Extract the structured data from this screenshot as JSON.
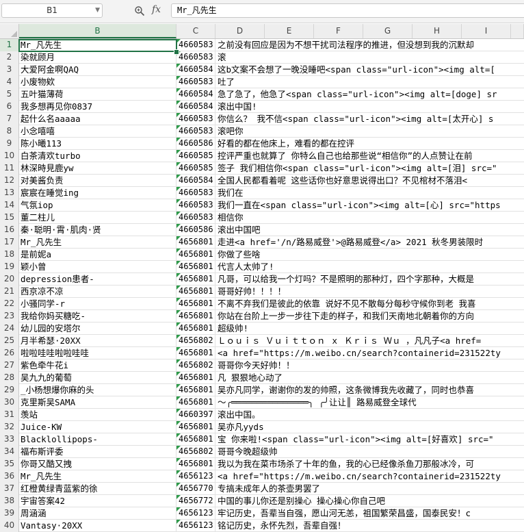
{
  "formula_bar": {
    "namebox": "B1",
    "fx_label": "fx",
    "content": "Mr_凡先生"
  },
  "columns": [
    "B",
    "C",
    "D",
    "E",
    "F",
    "G",
    "H",
    "I"
  ],
  "selected_column": "B",
  "rows": [
    {
      "n": "1",
      "b": "Mr_凡先生",
      "c": "4660583",
      "d": "之前没有回应是因为不想干扰司法程序的推进，但没想到我的沉默却"
    },
    {
      "n": "2",
      "b": "染就顾月",
      "c": "4660583",
      "d": "滚"
    },
    {
      "n": "3",
      "b": "大爱阿金啊QAQ",
      "c": "4660584",
      "d": "这b文案不会想了一晚没睡吧<span class=\"url-icon\"><img alt=["
    },
    {
      "n": "4",
      "b": "小废物欸",
      "c": "4660583",
      "d": "吐了"
    },
    {
      "n": "5",
      "b": "五叶猫薄荷",
      "c": "4660584",
      "d": "急了急了，他急了<span class=\"url-icon\"><img alt=[doge] sr"
    },
    {
      "n": "6",
      "b": "我多想再见你0837",
      "c": "4660584",
      "d": "滚出中国!"
    },
    {
      "n": "7",
      "b": "起什么名aaaaa",
      "c": "4660583",
      "d": "你信么？ 我不信<span class=\"url-icon\"><img alt=[太开心] s"
    },
    {
      "n": "8",
      "b": "小念嘻嘻",
      "c": "4660583",
      "d": "滚吧你"
    },
    {
      "n": "9",
      "b": "陈小曦113",
      "c": "4660586",
      "d": "好看的都在他床上，难看的都在控评"
    },
    {
      "n": "10",
      "b": "白茶清欢turbo",
      "c": "4660585",
      "d": "控评严重也就算了 你特么自己也给那些说“相信你”的人点赞让在前"
    },
    {
      "n": "11",
      "b": "林深時見鹿yw",
      "c": "4660585",
      "d": "签子 我们相信你<span class=\"url-icon\"><img alt=[泪] src=\""
    },
    {
      "n": "12",
      "b": "对美酱负责",
      "c": "4660584",
      "d": "全国人民都看着呢   这些话你也好意思说得出口？不见棺材不落泪<"
    },
    {
      "n": "13",
      "b": "宸宸在睡觉ing",
      "c": "4660583",
      "d": "我们在"
    },
    {
      "n": "14",
      "b": "气氛iop",
      "c": "4660583",
      "d": "我们一直在<span class=\"url-icon\"><img alt=[心] src=\"https"
    },
    {
      "n": "15",
      "b": "董二柱儿",
      "c": "4660583",
      "d": "相信你"
    },
    {
      "n": "16",
      "b": "秦·聪明·霄·肌肉·贤",
      "c": "4660586",
      "d": "滚出中国吧"
    },
    {
      "n": "17",
      "b": "Mr_凡先生",
      "c": "4656801",
      "d": "走进<a href='/n/路易威登'>@路易威登</a> 2021 秋冬男装限时"
    },
    {
      "n": "18",
      "b": "是前妮a",
      "c": "4656801",
      "d": "你做了些啥"
    },
    {
      "n": "19",
      "b": "颖小曾",
      "c": "4656801",
      "d": "代言人太帅了!"
    },
    {
      "n": "20",
      "b": "depression患者-",
      "c": "4656801",
      "d": "凡哥，可以给我一个灯吗？不是照明的那种灯，四个字那种，大概是"
    },
    {
      "n": "21",
      "b": "西京凉不凉",
      "c": "4656801",
      "d": "哥哥好帅！！！！"
    },
    {
      "n": "22",
      "b": "小骚同学-r",
      "c": "4656801",
      "d": "不离不弃我们是彼此的依靠 说好不见不散每分每秒守候你到老 我喜"
    },
    {
      "n": "23",
      "b": "我给你妈买糖吃-",
      "c": "4656801",
      "d": "你站在台阶上一步一步往下走的样子，和我们天南地北朝着你的方向"
    },
    {
      "n": "24",
      "b": "幼儿园的安塔尔",
      "c": "4656801",
      "d": "超级帅!"
    },
    {
      "n": "25",
      "b": "月半希瑟·20XX",
      "c": "4656802",
      "d": "Ｌｏｕｉｓ Ｖｕｉｔｔｏｎ ｘ Ｋｒｉｓ Ｗｕ ，凡凡子<a href="
    },
    {
      "n": "26",
      "b": "啦啦哇哇啦啦哇哇",
      "c": "4656801",
      "d": "<a  href=\"https://m.weibo.cn/search?containerid=231522ty"
    },
    {
      "n": "27",
      "b": "紫色牵牛花i",
      "c": "4656802",
      "d": "哥哥你今天好帅！！"
    },
    {
      "n": "28",
      "b": "吴九九的葡萄",
      "c": "4656801",
      "d": "凡 狠狠地心动了"
    },
    {
      "n": "29",
      "b": "_小杨想爆你麻的头",
      "c": "4656801",
      "d": "吴亦凡同学，谢谢你的发的帅照，这条微博我先收藏了，同时也恭喜"
    },
    {
      "n": "30",
      "b": "克里斯吴SAMA",
      "c": "4656801",
      "d": "～╭═══════════════╮ ╭╯让让║ 路易威登全球代"
    },
    {
      "n": "31",
      "b": "羡站",
      "c": "4660397",
      "d": "滚出中国。"
    },
    {
      "n": "32",
      "b": "Juice-KW",
      "c": "4656801",
      "d": "吴亦凡yyds"
    },
    {
      "n": "33",
      "b": "Blacklollipops-",
      "c": "4656801",
      "d": "宝 你来啦!<span class=\"url-icon\"><img alt=[好喜欢] src=\""
    },
    {
      "n": "34",
      "b": "福布斯评委",
      "c": "4656802",
      "d": "哥哥今晚超级帅"
    },
    {
      "n": "35",
      "b": "你哥又酷又拽",
      "c": "4656801",
      "d": "我以为我在菜市场杀了十年的鱼，我的心已经像杀鱼刀那般冰冷，可"
    },
    {
      "n": "36",
      "b": "Mr_凡先生",
      "c": "4656123",
      "d": "<a  href=\"https://m.weibo.cn/search?containerid=231522ty"
    },
    {
      "n": "37",
      "b": "红橙黄绿青蓝紫的徐",
      "c": "4656770",
      "d": "专搞未成年人的茶壶男罢了"
    },
    {
      "n": "38",
      "b": "宇宙答案42",
      "c": "4656772",
      "d": "中国的事儿你还是别操心 操心操心你自己吧"
    },
    {
      "n": "39",
      "b": "周涵涵",
      "c": "4656123",
      "d": "牢记历史，吾辈当自强，愿山河无恙，祖国繁荣昌盛，国泰民安！c"
    },
    {
      "n": "40",
      "b": "Vantasy·20XX",
      "c": "4656123",
      "d": "铭记历史，永怀先烈，吾辈自强！"
    }
  ]
}
